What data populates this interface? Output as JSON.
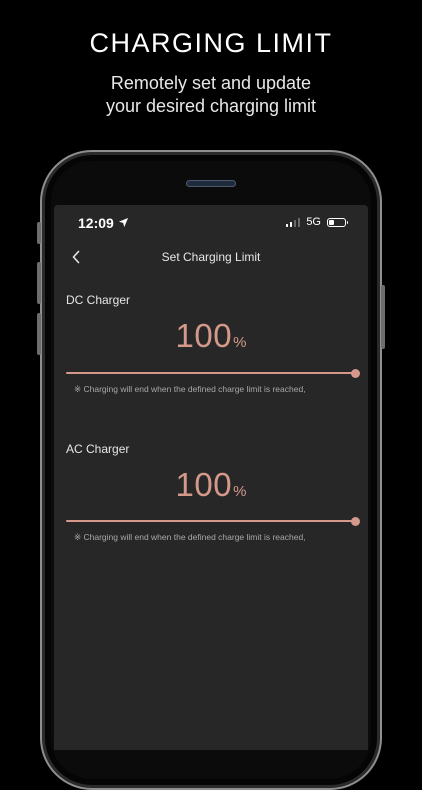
{
  "promo": {
    "headline": "CHARGING LIMIT",
    "sub_line1": "Remotely set and update",
    "sub_line2": "your desired charging limit"
  },
  "status_bar": {
    "time": "12:09",
    "network": "5G",
    "location_icon": "location-arrow-icon",
    "signal_icon": "cellular-signal-icon",
    "battery_icon": "battery-icon",
    "battery_level": 0.35
  },
  "nav": {
    "back_icon": "chevron-left-icon",
    "title": "Set Charging Limit"
  },
  "dc": {
    "label": "DC Charger",
    "value": "100",
    "unit": "%",
    "slider_fraction": 1.0,
    "note": "※ Charging will end when the defined charge limit is reached,"
  },
  "ac": {
    "label": "AC Charger",
    "value": "100",
    "unit": "%",
    "slider_fraction": 1.0,
    "note": "※ Charging will end when the defined charge limit is reached,"
  },
  "colors": {
    "accent": "#d4998a",
    "screen_bg": "#272727",
    "background": "#000000"
  }
}
